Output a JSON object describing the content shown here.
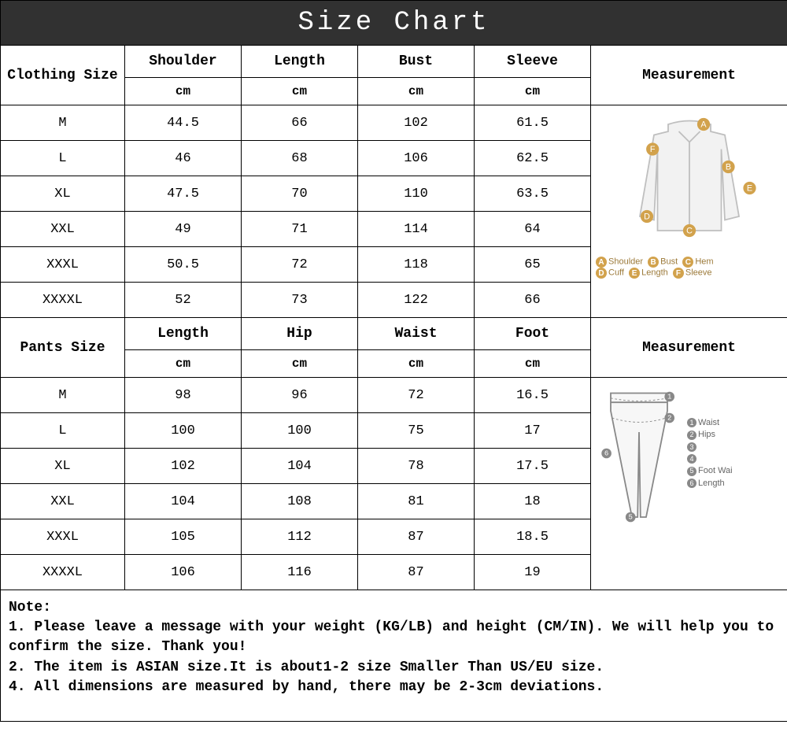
{
  "title": "Size  Chart",
  "clothing": {
    "label": "Clothing Size",
    "columns": [
      "Shoulder",
      "Length",
      "Bust",
      "Sleeve"
    ],
    "unit": "cm",
    "measurement_label": "Measurement",
    "rows": [
      {
        "size": "M",
        "vals": [
          "44.5",
          "66",
          "102",
          "61.5"
        ]
      },
      {
        "size": "L",
        "vals": [
          "46",
          "68",
          "106",
          "62.5"
        ]
      },
      {
        "size": "XL",
        "vals": [
          "47.5",
          "70",
          "110",
          "63.5"
        ]
      },
      {
        "size": "XXL",
        "vals": [
          "49",
          "71",
          "114",
          "64"
        ]
      },
      {
        "size": "XXXL",
        "vals": [
          "50.5",
          "72",
          "118",
          "65"
        ]
      },
      {
        "size": "XXXXL",
        "vals": [
          "52",
          "73",
          "122",
          "66"
        ]
      }
    ],
    "legend": [
      {
        "k": "A",
        "v": "Shoulder"
      },
      {
        "k": "B",
        "v": "Bust"
      },
      {
        "k": "C",
        "v": "Hem"
      },
      {
        "k": "D",
        "v": "Cuff"
      },
      {
        "k": "E",
        "v": "Length"
      },
      {
        "k": "F",
        "v": "Sleeve"
      }
    ]
  },
  "pants": {
    "label": "Pants Size",
    "columns": [
      "Length",
      "Hip",
      "Waist",
      "Foot"
    ],
    "unit": "cm",
    "measurement_label": "Measurement",
    "rows": [
      {
        "size": "M",
        "vals": [
          "98",
          "96",
          "72",
          "16.5"
        ]
      },
      {
        "size": "L",
        "vals": [
          "100",
          "100",
          "75",
          "17"
        ]
      },
      {
        "size": "XL",
        "vals": [
          "102",
          "104",
          "78",
          "17.5"
        ]
      },
      {
        "size": "XXL",
        "vals": [
          "104",
          "108",
          "81",
          "18"
        ]
      },
      {
        "size": "XXXL",
        "vals": [
          "105",
          "112",
          "87",
          "18.5"
        ]
      },
      {
        "size": "XXXXL",
        "vals": [
          "106",
          "116",
          "87",
          "19"
        ]
      }
    ],
    "legend": [
      {
        "k": "1",
        "v": "Waist"
      },
      {
        "k": "2",
        "v": "Hips"
      },
      {
        "k": "3",
        "v": ""
      },
      {
        "k": "4",
        "v": ""
      },
      {
        "k": "5",
        "v": "Foot Wai"
      },
      {
        "k": "6",
        "v": "Length"
      }
    ]
  },
  "note": {
    "heading": "Note:",
    "lines": [
      "1. Please leave a message with your weight (KG/LB) and height (CM/IN). We will help you to confirm the size. Thank you!",
      "2. The item is ASIAN size.It is about1-2 size Smaller Than US/EU size.",
      "4. All dimensions are measured by hand, there may be 2-3cm deviations."
    ]
  },
  "chart_data": [
    {
      "type": "table",
      "title": "Clothing Size (cm)",
      "columns": [
        "Size",
        "Shoulder",
        "Length",
        "Bust",
        "Sleeve"
      ],
      "rows": [
        [
          "M",
          44.5,
          66,
          102,
          61.5
        ],
        [
          "L",
          46,
          68,
          106,
          62.5
        ],
        [
          "XL",
          47.5,
          70,
          110,
          63.5
        ],
        [
          "XXL",
          49,
          71,
          114,
          64
        ],
        [
          "XXXL",
          50.5,
          72,
          118,
          65
        ],
        [
          "XXXXL",
          52,
          73,
          122,
          66
        ]
      ]
    },
    {
      "type": "table",
      "title": "Pants Size (cm)",
      "columns": [
        "Size",
        "Length",
        "Hip",
        "Waist",
        "Foot"
      ],
      "rows": [
        [
          "M",
          98,
          96,
          72,
          16.5
        ],
        [
          "L",
          100,
          100,
          75,
          17
        ],
        [
          "XL",
          102,
          104,
          78,
          17.5
        ],
        [
          "XXL",
          104,
          108,
          81,
          18
        ],
        [
          "XXXL",
          105,
          112,
          87,
          18.5
        ],
        [
          "XXXXL",
          106,
          116,
          87,
          19
        ]
      ]
    }
  ]
}
